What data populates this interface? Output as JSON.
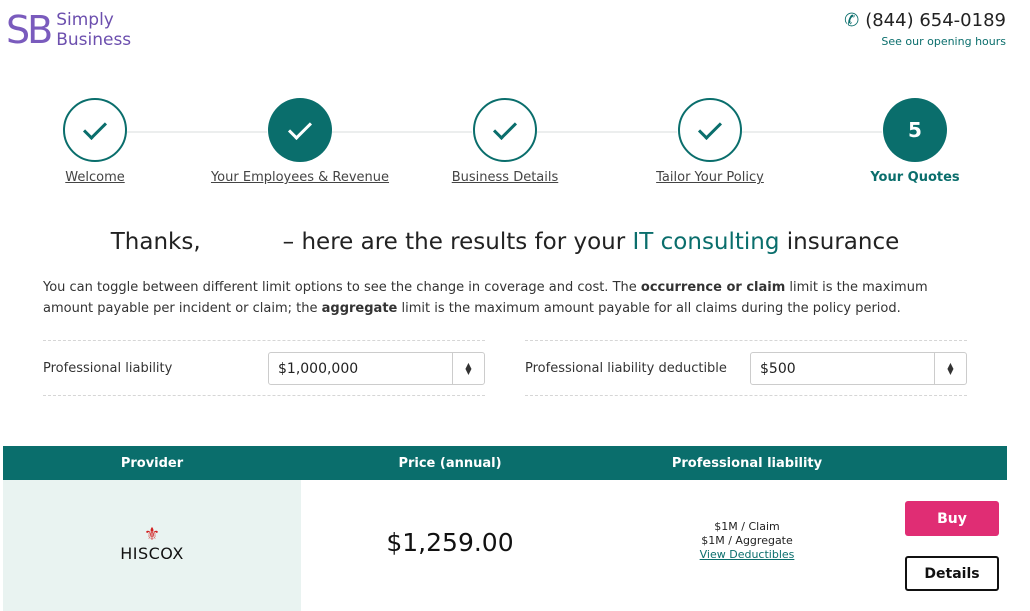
{
  "header": {
    "logo_mark": "SB",
    "logo_line1": "Simply",
    "logo_line2": "Business",
    "phone": "(844) 654-0189",
    "opening_hours_link": "See our opening hours",
    "brand_color": "#6c4fae",
    "accent_color": "#0a6e6c"
  },
  "steps": [
    {
      "label": "Welcome",
      "state": "done"
    },
    {
      "label": "Your Employees & Revenue",
      "state": "done-filled"
    },
    {
      "label": "Business Details",
      "state": "done"
    },
    {
      "label": "Tailor Your Policy",
      "state": "done"
    },
    {
      "label": "Your Quotes",
      "number": "5",
      "state": "active"
    }
  ],
  "headline": {
    "prefix": "Thanks,",
    "middle": "– here are the results for your",
    "highlight": "IT consulting",
    "suffix": "insurance"
  },
  "intro": {
    "part1": "You can toggle between different limit options to see the change in coverage and cost. The",
    "bold1": "occurrence or claim",
    "part2": "limit is the maximum amount payable per incident or claim; the",
    "bold2": "aggregate",
    "part3": "limit is the maximum amount payable for all claims during the policy period."
  },
  "selectors": {
    "liability_label": "Professional liability",
    "liability_value": "$1,000,000",
    "deductible_label": "Professional liability deductible",
    "deductible_value": "$500"
  },
  "table": {
    "headers": [
      "Provider",
      "Price (annual)",
      "Professional liability"
    ],
    "rows": [
      {
        "provider": "HISCOX",
        "price": "$1,259.00",
        "claim": "$1M / Claim",
        "aggregate": "$1M / Aggregate",
        "deductibles_link": "View Deductibles",
        "buy_label": "Buy",
        "details_label": "Details"
      }
    ],
    "buy_color": "#e02d74"
  }
}
